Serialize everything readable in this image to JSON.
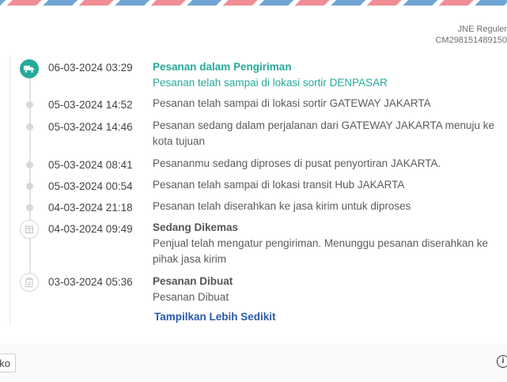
{
  "courier": {
    "name": "JNE Reguler",
    "tracking_no": "CM298151489150"
  },
  "timeline": [
    {
      "time": "06-03-2024 03:29",
      "title": "Pesanan dalam Pengiriman",
      "desc": "Pesanan telah sampai di lokasi sortir DENPASAR",
      "icon": "truck-icon"
    },
    {
      "time": "05-03-2024 14:52",
      "desc": "Pesanan telah sampai di lokasi sortir GATEWAY JAKARTA"
    },
    {
      "time": "05-03-2024 14:46",
      "desc": "Pesanan sedang dalam perjalanan dari GATEWAY JAKARTA menuju ke kota tujuan"
    },
    {
      "time": "05-03-2024 08:41",
      "desc": "Pesananmu sedang diproses di pusat penyortiran JAKARTA."
    },
    {
      "time": "05-03-2024 00:54",
      "desc": "Pesanan telah sampai di lokasi transit Hub JAKARTA"
    },
    {
      "time": "04-03-2024 21:18",
      "desc": "Pesanan telah diserahkan ke jasa kirim untuk diproses"
    },
    {
      "time": "04-03-2024 09:49",
      "title": "Sedang Dikemas",
      "desc": "Penjual telah mengatur pengiriman. Menunggu pesanan diserahkan ke pihak jasa kirim",
      "icon": "package-icon"
    },
    {
      "time": "03-03-2024 05:36",
      "title": "Pesanan Dibuat",
      "desc": "Pesanan Dibuat",
      "icon": "receipt-icon"
    }
  ],
  "toggle_link": "Tampilkan Lebih Sedikit",
  "bottom": {
    "chat_label": "ko",
    "info_icon": "info-icon"
  },
  "colors": {
    "accent": "#26aa99",
    "link": "#2a5aa8"
  }
}
